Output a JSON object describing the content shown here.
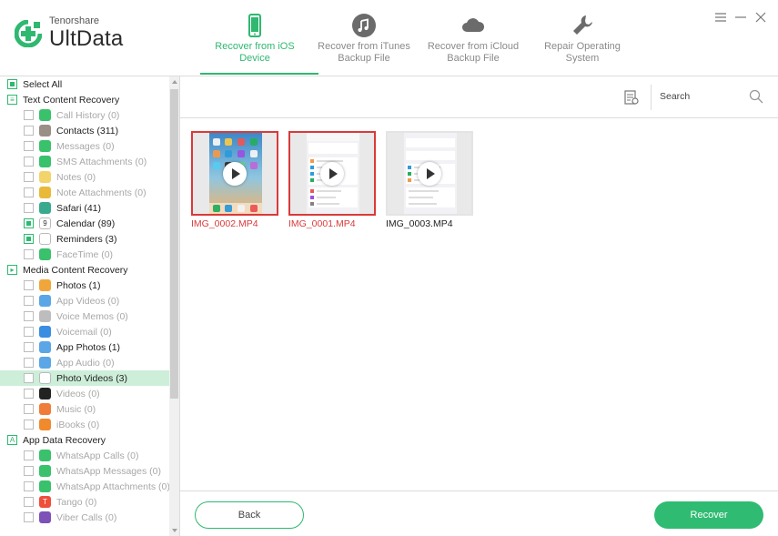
{
  "app": {
    "brand": "Tenorshare",
    "name": "UltData",
    "accent": "#2fb870"
  },
  "nav": {
    "tabs": [
      {
        "label": "Recover from iOS\nDevice",
        "active": true,
        "icon": "phone-icon"
      },
      {
        "label": "Recover from iTunes\nBackup File",
        "active": false,
        "icon": "music-note-icon"
      },
      {
        "label": "Recover from iCloud\nBackup File",
        "active": false,
        "icon": "cloud-icon"
      },
      {
        "label": "Repair Operating\nSystem",
        "active": false,
        "icon": "wrench-icon"
      }
    ]
  },
  "sidebar": {
    "select_all": "Select All",
    "text_category": "Text Content Recovery",
    "text_items": [
      {
        "label": "Call History (0)",
        "icon": "phone-call-icon",
        "color": "#39c16c",
        "dim": true,
        "checked": false
      },
      {
        "label": "Contacts (311)",
        "icon": "contacts-icon",
        "color": "#9a8f86",
        "dim": false,
        "checked": false
      },
      {
        "label": "Messages (0)",
        "icon": "message-icon",
        "color": "#39c16c",
        "dim": true,
        "checked": false
      },
      {
        "label": "SMS Attachments (0)",
        "icon": "attachment-icon",
        "color": "#39c16c",
        "dim": true,
        "checked": false
      },
      {
        "label": "Notes (0)",
        "icon": "notes-icon",
        "color": "#f3d46b",
        "dim": true,
        "checked": false
      },
      {
        "label": "Note Attachments (0)",
        "icon": "note-attachment-icon",
        "color": "#e9b93a",
        "dim": true,
        "checked": false
      },
      {
        "label": "Safari (41)",
        "icon": "safari-icon",
        "color": "#3aaa8e",
        "dim": false,
        "checked": false
      },
      {
        "label": "Calendar (89)",
        "icon": "calendar-icon",
        "color": "#ffffff",
        "dim": false,
        "checked": true,
        "glyph": "9"
      },
      {
        "label": "Reminders (3)",
        "icon": "reminders-icon",
        "color": "#ffffff",
        "dim": false,
        "checked": true
      },
      {
        "label": "FaceTime (0)",
        "icon": "facetime-icon",
        "color": "#39c16c",
        "dim": true,
        "checked": false
      }
    ],
    "media_category": "Media Content Recovery",
    "media_items": [
      {
        "label": "Photos (1)",
        "icon": "photos-icon",
        "color": "#f1a63b",
        "dim": false,
        "checked": false
      },
      {
        "label": "App Videos (0)",
        "icon": "app-videos-icon",
        "color": "#5aa6e6",
        "dim": true,
        "checked": false
      },
      {
        "label": "Voice Memos (0)",
        "icon": "voice-memos-icon",
        "color": "#bdbdbd",
        "dim": true,
        "checked": false
      },
      {
        "label": "Voicemail (0)",
        "icon": "voicemail-icon",
        "color": "#3a8de0",
        "dim": true,
        "checked": false
      },
      {
        "label": "App Photos (1)",
        "icon": "app-photos-icon",
        "color": "#5aa6e6",
        "dim": false,
        "checked": false
      },
      {
        "label": "App Audio (0)",
        "icon": "app-audio-icon",
        "color": "#5aa6e6",
        "dim": true,
        "checked": false
      },
      {
        "label": "Photo Videos (3)",
        "icon": "photo-videos-icon",
        "color": "#ffffff",
        "dim": false,
        "checked": false,
        "selected": true
      },
      {
        "label": "Videos (0)",
        "icon": "videos-icon",
        "color": "#222222",
        "dim": true,
        "checked": false
      },
      {
        "label": "Music (0)",
        "icon": "music-icon",
        "color": "#f07c3a",
        "dim": true,
        "checked": false
      },
      {
        "label": "iBooks (0)",
        "icon": "ibooks-icon",
        "color": "#f08a2c",
        "dim": true,
        "checked": false
      }
    ],
    "app_category": "App Data Recovery",
    "app_items": [
      {
        "label": "WhatsApp Calls (0)",
        "icon": "whatsapp-calls-icon",
        "color": "#39c16c",
        "dim": true,
        "checked": false
      },
      {
        "label": "WhatsApp Messages (0)",
        "icon": "whatsapp-messages-icon",
        "color": "#39c16c",
        "dim": true,
        "checked": false
      },
      {
        "label": "WhatsApp Attachments (0)",
        "icon": "whatsapp-attachments-icon",
        "color": "#39c16c",
        "dim": true,
        "checked": false
      },
      {
        "label": "Tango (0)",
        "icon": "tango-icon",
        "color": "#ef4e3a",
        "dim": true,
        "checked": false,
        "glyph": "T"
      },
      {
        "label": "Viber Calls (0)",
        "icon": "viber-icon",
        "color": "#7d51b8",
        "dim": true,
        "checked": false
      }
    ]
  },
  "toolbar": {
    "search_placeholder": "Search"
  },
  "gallery": {
    "files": [
      {
        "name": "IMG_0002.MP4",
        "selected": true,
        "preview": "home"
      },
      {
        "name": "IMG_0001.MP4",
        "selected": true,
        "preview": "settings"
      },
      {
        "name": "IMG_0003.MP4",
        "selected": false,
        "preview": "settings-dim"
      }
    ]
  },
  "footer": {
    "back_label": "Back",
    "recover_label": "Recover"
  }
}
